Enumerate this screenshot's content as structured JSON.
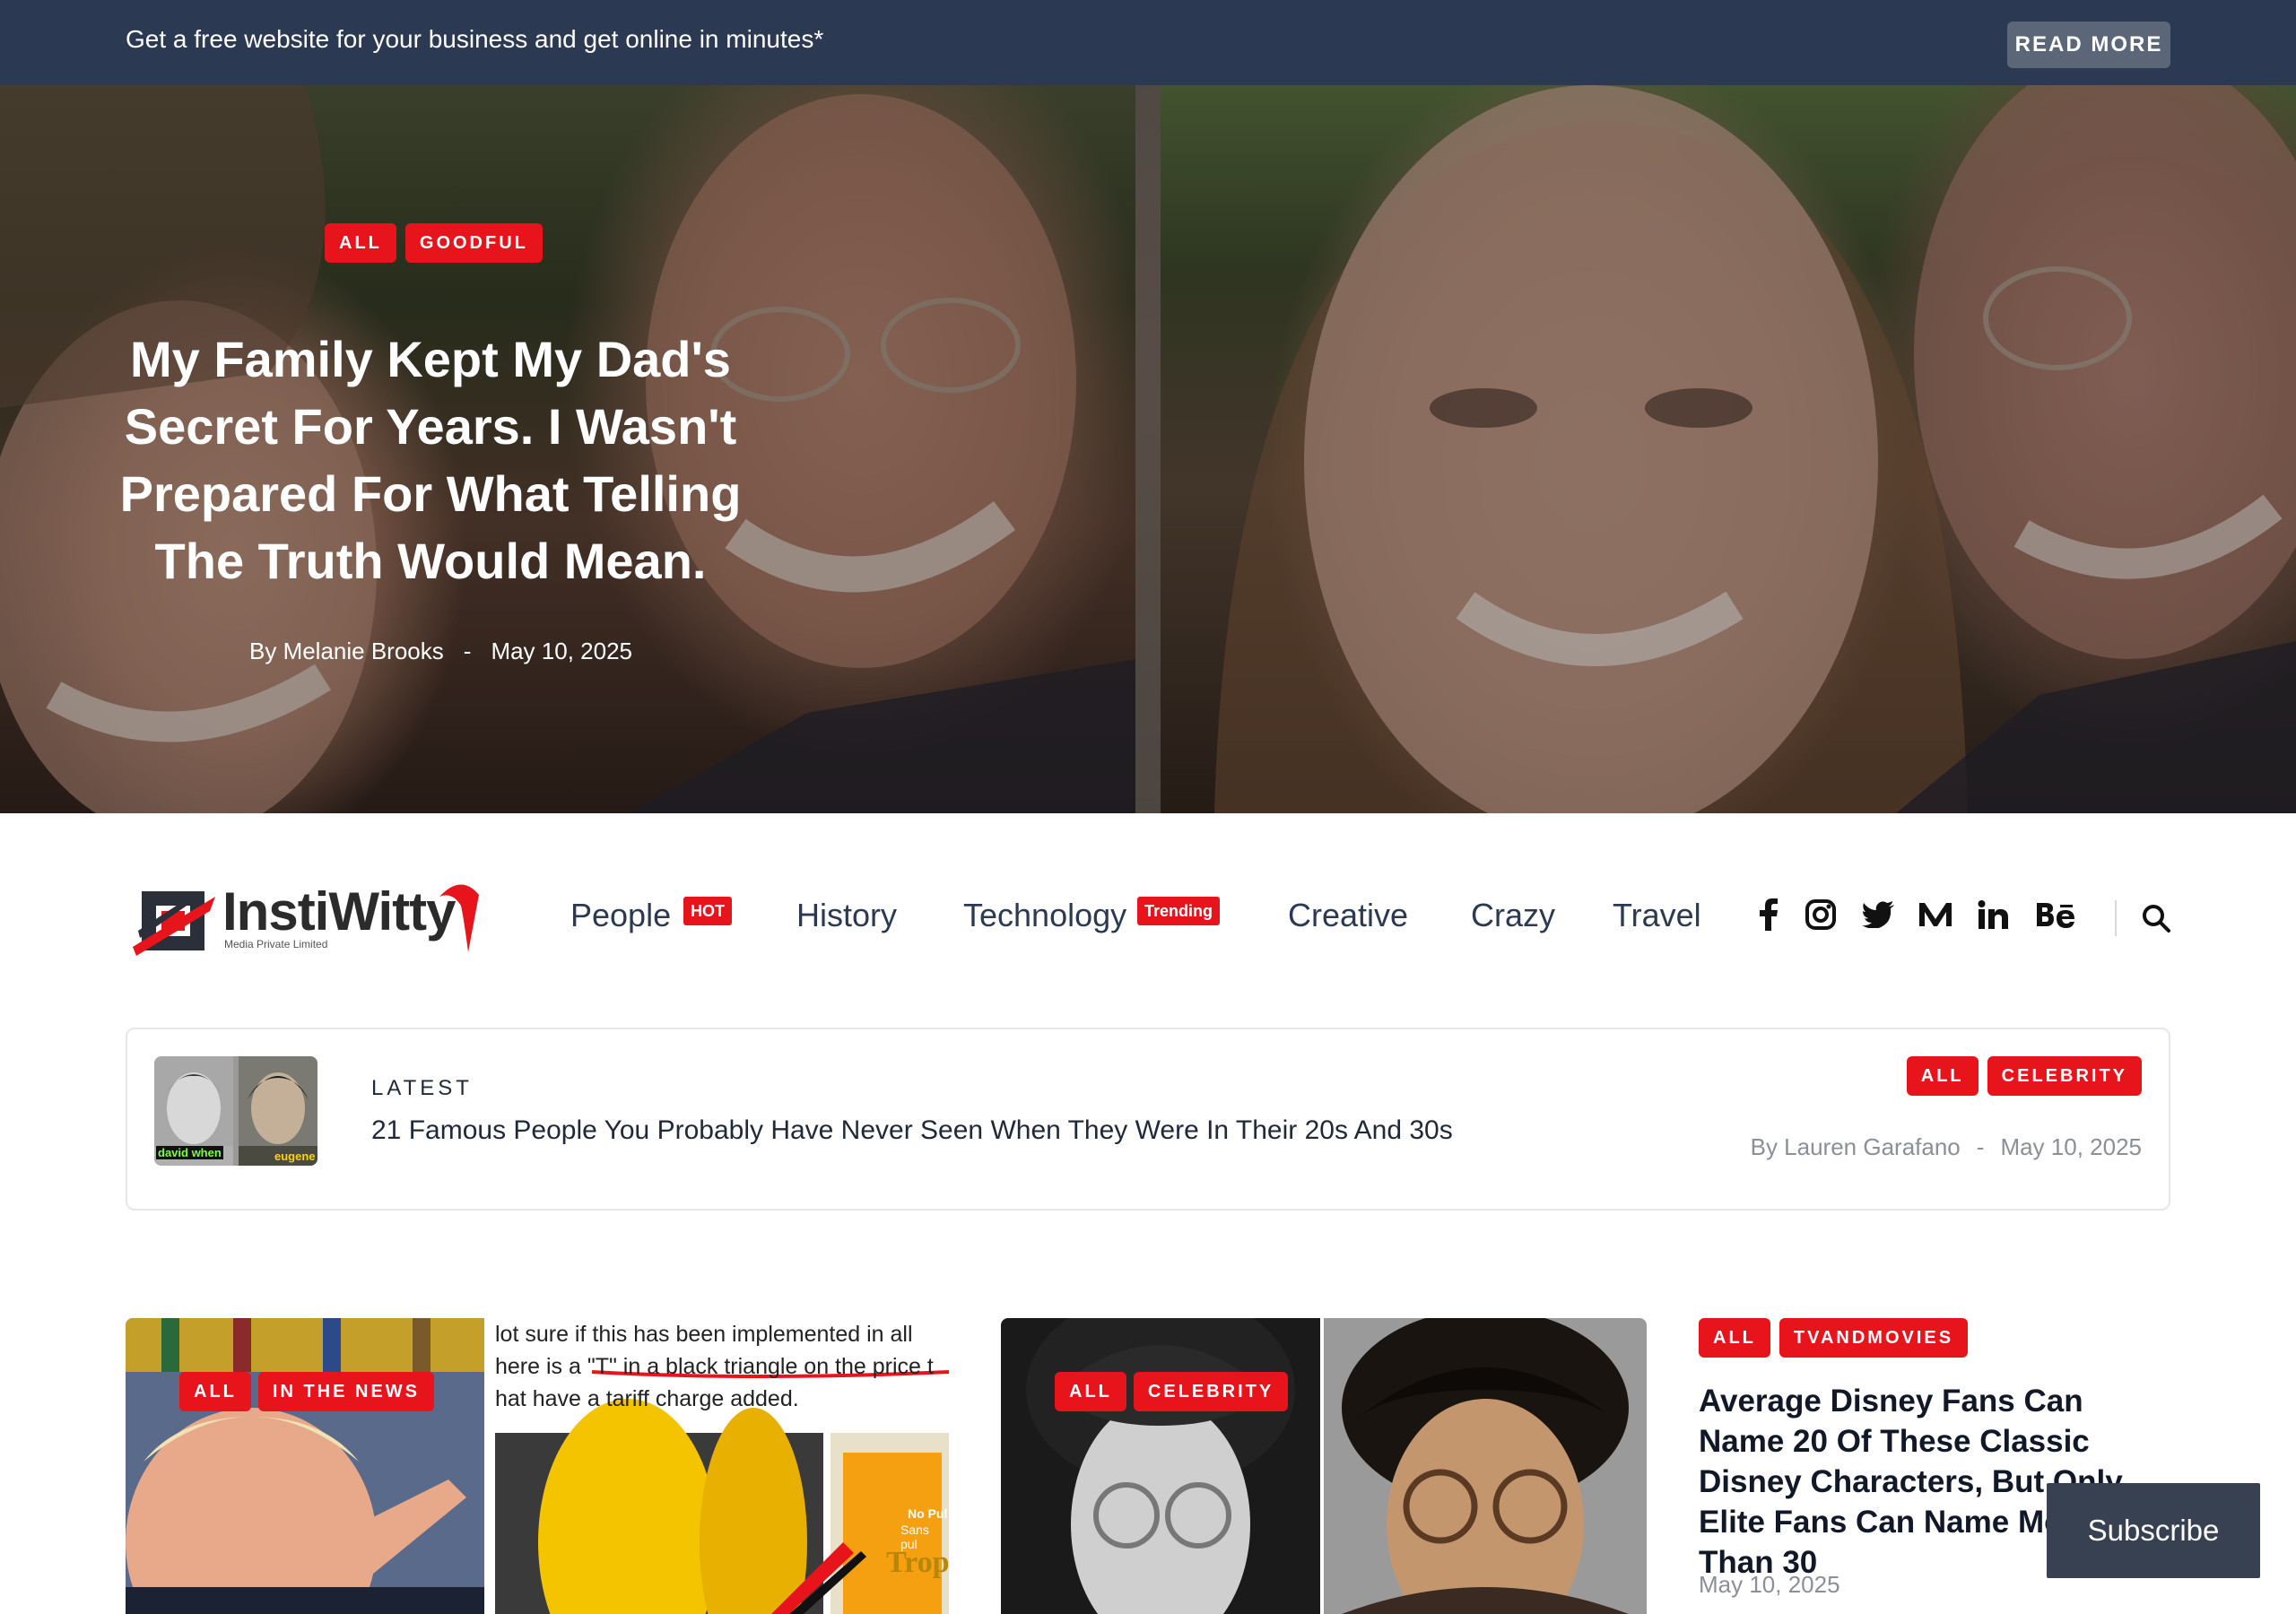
{
  "topbar": {
    "text": "Get a free website for your business and get online in minutes*",
    "button": "READ MORE"
  },
  "hero": {
    "tags": [
      "ALL",
      "GOODFUL"
    ],
    "title": "My Family Kept My Dad's Secret For Years. I Wasn't Prepared For What Telling The Truth Would Mean.",
    "author": "By Melanie Brooks",
    "separator": "-",
    "date": "May 10, 2025"
  },
  "logo": {
    "name": "InstiWitty",
    "subtitle": "Media Private Limited"
  },
  "nav": {
    "items": [
      {
        "label": "People",
        "badge": "HOT"
      },
      {
        "label": "History",
        "badge": ""
      },
      {
        "label": "Technology",
        "badge": "Trending"
      },
      {
        "label": "Creative",
        "badge": ""
      },
      {
        "label": "Crazy",
        "badge": ""
      },
      {
        "label": "Travel",
        "badge": ""
      }
    ],
    "social": [
      "facebook-icon",
      "instagram-icon",
      "twitter-icon",
      "medium-icon",
      "linkedin-icon",
      "behance-icon"
    ],
    "search_icon": "search-icon"
  },
  "latest": {
    "label": "LATEST",
    "title": "21 Famous People You Probably Have Never Seen When They Were In Their 20s And 30s",
    "tags": [
      "ALL",
      "CELEBRITY"
    ],
    "author": "By Lauren Garafano",
    "separator": "-",
    "date": "May 10, 2025",
    "thumb_captions": [
      "david when",
      "eugene"
    ]
  },
  "cards": [
    {
      "tags": [
        "ALL",
        "IN THE NEWS"
      ],
      "image_text": [
        "lot sure if this has been implemented in all",
        "here is a \"T\" in a black triangle on the price t",
        "hat have a tariff charge added."
      ],
      "image_product": [
        "No Pul",
        "Sans pul",
        "Tropic"
      ]
    },
    {
      "tags": [
        "ALL",
        "CELEBRITY"
      ]
    }
  ],
  "side": {
    "tags": [
      "ALL",
      "TVANDMOVIES"
    ],
    "title": "Average Disney Fans Can Name 20 Of These Classic Disney Characters, But Only Elite Fans Can Name More Than 30",
    "date": "May 10, 2025"
  },
  "subscribe": {
    "label": "Subscribe"
  },
  "colors": {
    "accent": "#e8141c",
    "topbar": "#2b3a52",
    "nav_text": "#2b3a52"
  }
}
